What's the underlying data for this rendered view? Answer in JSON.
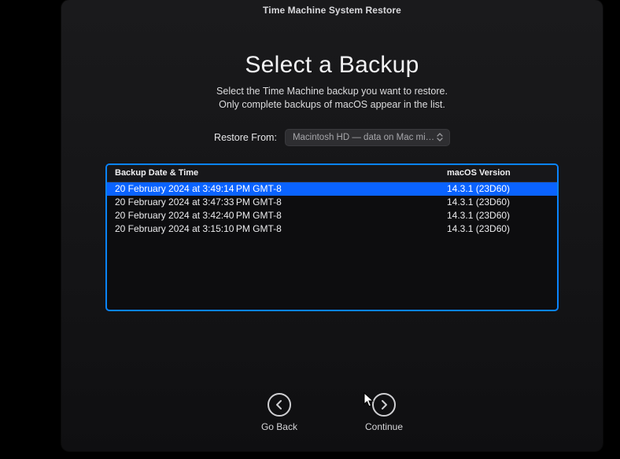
{
  "titlebar": "Time Machine System Restore",
  "heading": "Select a Backup",
  "sub1": "Select the Time Machine backup you want to restore.",
  "sub2": "Only complete backups of macOS appear in the list.",
  "restore": {
    "label": "Restore From:",
    "selected": "Macintosh HD — data on Mac mini -..."
  },
  "table": {
    "col_date": "Backup Date & Time",
    "col_ver": "macOS Version",
    "rows": [
      {
        "date": "20 February 2024 at 3:49:14 PM GMT-8",
        "ver": "14.3.1 (23D60)",
        "selected": true
      },
      {
        "date": "20 February 2024 at 3:47:33 PM GMT-8",
        "ver": "14.3.1 (23D60)",
        "selected": false
      },
      {
        "date": "20 February 2024 at 3:42:40 PM GMT-8",
        "ver": "14.3.1 (23D60)",
        "selected": false
      },
      {
        "date": "20 February 2024 at 3:15:10 PM GMT-8",
        "ver": "14.3.1 (23D60)",
        "selected": false
      }
    ]
  },
  "nav": {
    "back": "Go Back",
    "continue": "Continue"
  }
}
